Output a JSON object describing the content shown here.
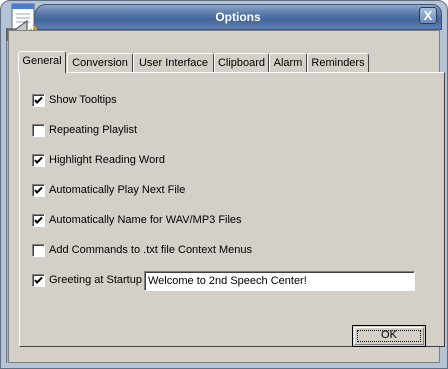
{
  "window": {
    "title": "Options",
    "close_glyph": "X",
    "app_icon": "speaker-notepad-icon"
  },
  "tabs": [
    {
      "label": "General",
      "active": true
    },
    {
      "label": "Conversion",
      "active": false
    },
    {
      "label": "User Interface",
      "active": false
    },
    {
      "label": "Clipboard",
      "active": false
    },
    {
      "label": "Alarm",
      "active": false
    },
    {
      "label": "Reminders",
      "active": false
    }
  ],
  "general": {
    "options": [
      {
        "label": "Show Tooltips",
        "checked": true
      },
      {
        "label": "Repeating Playlist",
        "checked": false
      },
      {
        "label": "Highlight Reading Word",
        "checked": true
      },
      {
        "label": "Automatically Play Next File",
        "checked": true
      },
      {
        "label": "Automatically Name for WAV/MP3 Files",
        "checked": true
      },
      {
        "label": "Add Commands to .txt file Context Menus",
        "checked": false
      },
      {
        "label": "Greeting at Startup",
        "checked": true
      }
    ],
    "greeting_text": "Welcome to 2nd Speech Center!"
  },
  "buttons": {
    "ok_label": "OK"
  },
  "colors": {
    "face": "#d4d0c8",
    "title_bar": "#4f6fa0",
    "title_text": "#ffffff"
  }
}
